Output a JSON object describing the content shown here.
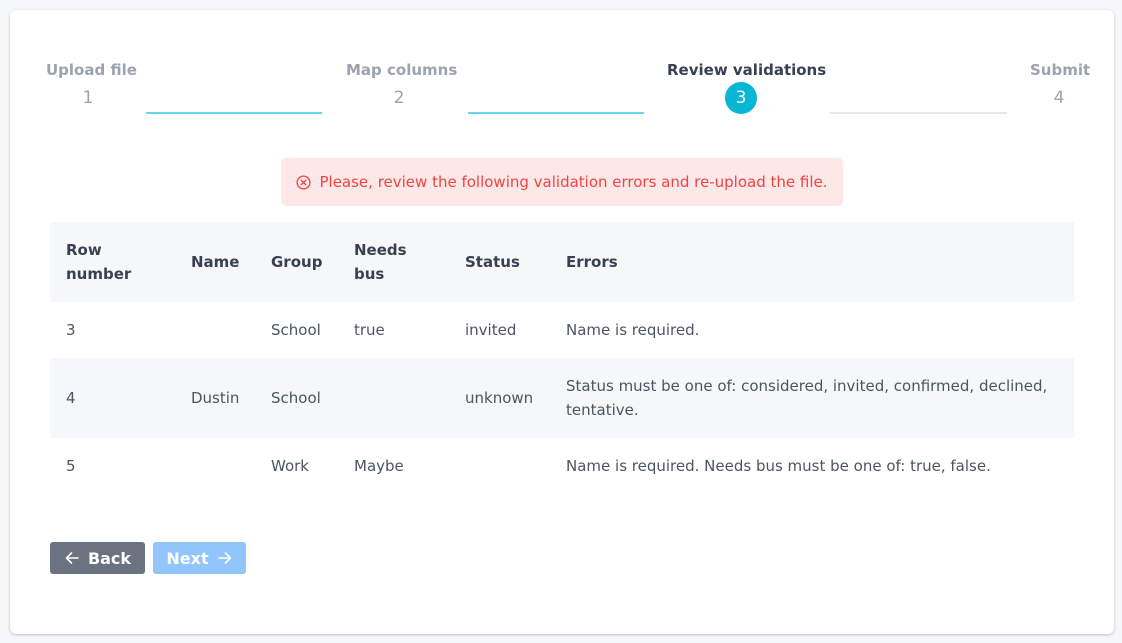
{
  "stepper": {
    "steps": [
      {
        "title": "Upload file",
        "number": "1",
        "state": "done"
      },
      {
        "title": "Map columns",
        "number": "2",
        "state": "done"
      },
      {
        "title": "Review validations",
        "number": "3",
        "state": "active"
      },
      {
        "title": "Submit",
        "number": "4",
        "state": "todo"
      }
    ]
  },
  "alert": {
    "message": "Please, review the following validation errors and re-upload the file.",
    "icon": "error-circle-icon",
    "color": "#ef4444"
  },
  "table": {
    "headers": [
      "Row number",
      "Name",
      "Group",
      "Needs bus",
      "Status",
      "Errors"
    ],
    "rows": [
      [
        "3",
        "",
        "School",
        "true",
        "invited",
        "Name is required."
      ],
      [
        "4",
        "Dustin",
        "School",
        "",
        "unknown",
        "Status must be one of: considered, invited, confirmed, declined, tentative."
      ],
      [
        "5",
        "",
        "Work",
        "Maybe",
        "",
        "Name is required. Needs bus must be one of: true, false."
      ]
    ]
  },
  "buttons": {
    "back_label": "Back",
    "next_label": "Next"
  },
  "colors": {
    "accent": "#06b6d4",
    "back_button": "#6b7280",
    "next_button_disabled": "#93c5fd"
  }
}
